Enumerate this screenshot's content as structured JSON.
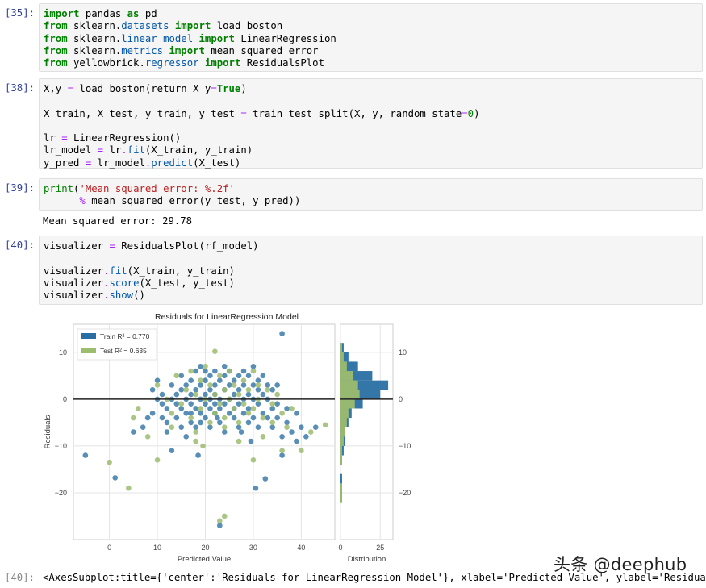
{
  "cells": [
    {
      "prompt": "[35]:",
      "lines": [
        [
          [
            "kw",
            "import"
          ],
          [
            "t",
            " pandas "
          ],
          [
            "kw",
            "as"
          ],
          [
            "t",
            " pd"
          ]
        ],
        [
          [
            "kw",
            "from"
          ],
          [
            "t",
            " sklearn."
          ],
          [
            "mod",
            "datasets"
          ],
          [
            "t",
            " "
          ],
          [
            "kw",
            "import"
          ],
          [
            "t",
            " load_boston"
          ]
        ],
        [
          [
            "kw",
            "from"
          ],
          [
            "t",
            " sklearn."
          ],
          [
            "mod",
            "linear_model"
          ],
          [
            "t",
            " "
          ],
          [
            "kw",
            "import"
          ],
          [
            "t",
            " LinearRegression"
          ]
        ],
        [
          [
            "kw",
            "from"
          ],
          [
            "t",
            " sklearn."
          ],
          [
            "mod",
            "metrics"
          ],
          [
            "t",
            " "
          ],
          [
            "kw",
            "import"
          ],
          [
            "t",
            " mean_squared_error"
          ]
        ],
        [
          [
            "kw",
            "from"
          ],
          [
            "t",
            " yellowbrick."
          ],
          [
            "mod",
            "regressor"
          ],
          [
            "t",
            " "
          ],
          [
            "kw",
            "import"
          ],
          [
            "t",
            " ResidualsPlot"
          ]
        ]
      ]
    },
    {
      "prompt": "[38]:",
      "lines": [
        [
          [
            "t",
            "X,y "
          ],
          [
            "op",
            "="
          ],
          [
            "t",
            " load_boston(return_X_y"
          ],
          [
            "op",
            "="
          ],
          [
            "kw",
            "True"
          ],
          [
            "t",
            ")"
          ]
        ],
        [],
        [
          [
            "t",
            "X_train, X_test, y_train, y_test "
          ],
          [
            "op",
            "="
          ],
          [
            "t",
            " train_test_split(X, y, random_state"
          ],
          [
            "op",
            "="
          ],
          [
            "kw2",
            "0"
          ],
          [
            "t",
            ")"
          ]
        ],
        [],
        [
          [
            "t",
            "lr "
          ],
          [
            "op",
            "="
          ],
          [
            "t",
            " LinearRegression()"
          ]
        ],
        [
          [
            "t",
            "lr_model "
          ],
          [
            "op",
            "="
          ],
          [
            "t",
            " lr"
          ],
          [
            "op",
            "."
          ],
          [
            "mod",
            "fit"
          ],
          [
            "t",
            "(X_train, y_train)"
          ]
        ],
        [
          [
            "t",
            "y_pred "
          ],
          [
            "op",
            "="
          ],
          [
            "t",
            " lr_model"
          ],
          [
            "op",
            "."
          ],
          [
            "mod",
            "predict"
          ],
          [
            "t",
            "(X_test)"
          ]
        ]
      ]
    },
    {
      "prompt": "[39]:",
      "lines": [
        [
          [
            "bi",
            "print"
          ],
          [
            "t",
            "("
          ],
          [
            "str",
            "'Mean squared error: %.2f'"
          ]
        ],
        [
          [
            "t",
            "      "
          ],
          [
            "op",
            "%"
          ],
          [
            "t",
            " mean_squared_error(y_test, y_pred))"
          ]
        ]
      ],
      "output": "Mean squared error: 29.78"
    },
    {
      "prompt": "[40]:",
      "lines": [
        [
          [
            "t",
            "visualizer "
          ],
          [
            "op",
            "="
          ],
          [
            "t",
            " ResidualsPlot(rf_model)"
          ]
        ],
        [],
        [
          [
            "t",
            "visualizer"
          ],
          [
            "op",
            "."
          ],
          [
            "mod",
            "fit"
          ],
          [
            "t",
            "(X_train, y_train)"
          ]
        ],
        [
          [
            "t",
            "visualizer"
          ],
          [
            "op",
            "."
          ],
          [
            "mod",
            "score"
          ],
          [
            "t",
            "(X_test, y_test)"
          ]
        ],
        [
          [
            "t",
            "visualizer"
          ],
          [
            "op",
            "."
          ],
          [
            "mod",
            "show"
          ],
          [
            "t",
            "()"
          ]
        ]
      ]
    }
  ],
  "final_output": {
    "prompt": "[40]:",
    "text": "<AxesSubplot:title={'center':'Residuals for LinearRegression Model'}, xlabel='Predicted Value', ylabel='Residuals'>"
  },
  "watermark": "头条 @deephub",
  "colors": {
    "train": "#2a6fa3",
    "test": "#9cbc6e",
    "prompt": "#303f9f"
  },
  "chart_data": {
    "type": "scatter",
    "title": "Residuals for LinearRegression Model",
    "xlabel": "Predicted Value",
    "ylabel": "Residuals",
    "dist_xlabel": "Distribution",
    "xlim": [
      -7.5,
      47
    ],
    "ylim": [
      -30,
      16
    ],
    "xticks": [
      0,
      10,
      20,
      30,
      40
    ],
    "yticks": [
      10,
      0,
      -10,
      -20
    ],
    "dist_xticks": [
      0,
      25
    ],
    "dist_xlim": [
      0,
      33
    ],
    "legend": [
      {
        "label": "Train R² = 0.770",
        "color": "#2a6fa3"
      },
      {
        "label": "Test R² = 0.635",
        "color": "#9cbc6e"
      }
    ],
    "legend_position": "top-left",
    "zero_line": 0,
    "series": [
      {
        "name": "Train",
        "points": [
          [
            -5,
            -12
          ],
          [
            1.2,
            -16.8
          ],
          [
            5,
            -7
          ],
          [
            7,
            -6
          ],
          [
            8,
            -4
          ],
          [
            9,
            2
          ],
          [
            9,
            -3
          ],
          [
            10,
            4
          ],
          [
            10,
            0
          ],
          [
            11,
            -1
          ],
          [
            11,
            -4
          ],
          [
            11,
            1
          ],
          [
            12,
            -2
          ],
          [
            12,
            -5
          ],
          [
            12,
            -7
          ],
          [
            13,
            0
          ],
          [
            13,
            3
          ],
          [
            14,
            -1
          ],
          [
            14,
            1
          ],
          [
            14,
            -4
          ],
          [
            15,
            2
          ],
          [
            15,
            5
          ],
          [
            15,
            -2
          ],
          [
            15,
            -6
          ],
          [
            16,
            0
          ],
          [
            16,
            3
          ],
          [
            16,
            -3
          ],
          [
            16,
            -8
          ],
          [
            17,
            1
          ],
          [
            17,
            4
          ],
          [
            17,
            -1
          ],
          [
            17,
            -5
          ],
          [
            18,
            2
          ],
          [
            18,
            6
          ],
          [
            18,
            -2
          ],
          [
            18,
            -6
          ],
          [
            19,
            0
          ],
          [
            19,
            3
          ],
          [
            19,
            -3
          ],
          [
            19,
            -5
          ],
          [
            19,
            7
          ],
          [
            20,
            1
          ],
          [
            20,
            4
          ],
          [
            20,
            -1
          ],
          [
            20,
            -4
          ],
          [
            20,
            6
          ],
          [
            21,
            2
          ],
          [
            21,
            5
          ],
          [
            21,
            -2
          ],
          [
            21,
            -6
          ],
          [
            21,
            0
          ],
          [
            22,
            1
          ],
          [
            22,
            3
          ],
          [
            22,
            -1
          ],
          [
            22,
            -3
          ],
          [
            22,
            6
          ],
          [
            23,
            0
          ],
          [
            23,
            4
          ],
          [
            23,
            -2
          ],
          [
            23,
            -5
          ],
          [
            24,
            2
          ],
          [
            24,
            5
          ],
          [
            24,
            -1
          ],
          [
            24,
            -7
          ],
          [
            24,
            7
          ],
          [
            25,
            0
          ],
          [
            25,
            3
          ],
          [
            25,
            -3
          ],
          [
            25,
            6
          ],
          [
            26,
            1
          ],
          [
            26,
            4
          ],
          [
            26,
            -2
          ],
          [
            26,
            -4
          ],
          [
            27,
            2
          ],
          [
            27,
            5
          ],
          [
            27,
            -1
          ],
          [
            27,
            -6
          ],
          [
            28,
            0
          ],
          [
            28,
            3
          ],
          [
            28,
            -3
          ],
          [
            28,
            6
          ],
          [
            29,
            1
          ],
          [
            29,
            5
          ],
          [
            29,
            -2
          ],
          [
            29,
            -5
          ],
          [
            30,
            0
          ],
          [
            30,
            3
          ],
          [
            30,
            -4
          ],
          [
            30,
            7
          ],
          [
            31,
            2
          ],
          [
            31,
            -1
          ],
          [
            31,
            -6
          ],
          [
            31,
            4
          ],
          [
            32,
            1
          ],
          [
            32,
            -3
          ],
          [
            32,
            5
          ],
          [
            33,
            0
          ],
          [
            33,
            -4
          ],
          [
            33,
            3
          ],
          [
            34,
            -2
          ],
          [
            34,
            2
          ],
          [
            34,
            -6
          ],
          [
            35,
            -1
          ],
          [
            35,
            -4
          ],
          [
            35,
            3
          ],
          [
            36,
            14
          ],
          [
            36,
            -8
          ],
          [
            36,
            -12
          ],
          [
            37,
            -5
          ],
          [
            37,
            -2
          ],
          [
            38,
            -7
          ],
          [
            39,
            -9
          ],
          [
            39,
            -3
          ],
          [
            40,
            -6
          ],
          [
            41,
            -8
          ],
          [
            43,
            -6
          ],
          [
            30.5,
            -19
          ],
          [
            32.5,
            -17
          ],
          [
            23,
            -27
          ],
          [
            13,
            -11
          ],
          [
            18.5,
            -12
          ],
          [
            17,
            -3
          ],
          [
            22.5,
            -4
          ],
          [
            27.5,
            -7
          ],
          [
            29.5,
            -9
          ]
        ]
      },
      {
        "name": "Test",
        "points": [
          [
            0,
            -13.5
          ],
          [
            4,
            -19
          ],
          [
            5,
            -4
          ],
          [
            6,
            -2
          ],
          [
            8,
            -8
          ],
          [
            10,
            3
          ],
          [
            12,
            0
          ],
          [
            13,
            -3
          ],
          [
            14,
            5
          ],
          [
            15,
            -1
          ],
          [
            16,
            2
          ],
          [
            17,
            6
          ],
          [
            17,
            -4
          ],
          [
            18,
            1
          ],
          [
            18,
            -7
          ],
          [
            19,
            4
          ],
          [
            19,
            -2
          ],
          [
            20,
            0
          ],
          [
            20,
            7
          ],
          [
            21,
            3
          ],
          [
            21,
            -5
          ],
          [
            22,
            1
          ],
          [
            22,
            -3
          ],
          [
            23,
            5
          ],
          [
            23,
            -1
          ],
          [
            22,
            10.2
          ],
          [
            24,
            2
          ],
          [
            24,
            -4
          ],
          [
            25,
            6
          ],
          [
            25,
            0
          ],
          [
            26,
            -2
          ],
          [
            26,
            3
          ],
          [
            27,
            1
          ],
          [
            27,
            -5
          ],
          [
            28,
            4
          ],
          [
            28,
            -1
          ],
          [
            29,
            2
          ],
          [
            29,
            -3
          ],
          [
            30,
            6
          ],
          [
            30,
            -2
          ],
          [
            31,
            0
          ],
          [
            31,
            3
          ],
          [
            32,
            -4
          ],
          [
            32,
            -8
          ],
          [
            33,
            2
          ],
          [
            34,
            -5
          ],
          [
            34,
            -1
          ],
          [
            35,
            1
          ],
          [
            36,
            -3
          ],
          [
            36,
            -11
          ],
          [
            37,
            -6
          ],
          [
            38,
            -2
          ],
          [
            40,
            -11
          ],
          [
            42,
            -7
          ],
          [
            45,
            -5.5
          ],
          [
            10,
            -13
          ],
          [
            18,
            -9
          ],
          [
            13,
            -6
          ],
          [
            24,
            -25
          ],
          [
            23,
            -26
          ],
          [
            30,
            -13
          ],
          [
            24,
            -6
          ],
          [
            27,
            -9
          ],
          [
            19.5,
            -10
          ]
        ]
      }
    ],
    "hist_bins": [
      -22,
      -20,
      -18,
      -16,
      -14,
      -12,
      -10,
      -8,
      -6,
      -4,
      -2,
      0,
      2,
      4,
      6,
      8,
      10,
      12
    ],
    "hist_train": [
      1,
      1,
      1,
      0,
      1,
      2,
      3,
      3,
      5,
      7,
      14,
      25,
      30,
      20,
      11,
      5,
      2
    ],
    "hist_test": [
      1,
      1,
      0,
      0,
      1,
      1,
      2,
      3,
      4,
      5,
      9,
      12,
      11,
      8,
      4,
      2,
      1
    ]
  }
}
